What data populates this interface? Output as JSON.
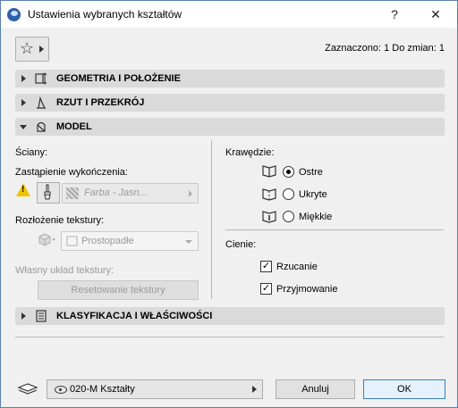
{
  "window": {
    "title": "Ustawienia wybranych kształtów",
    "help": "?",
    "close": "✕"
  },
  "toolbar": {
    "selection_info": "Zaznaczono: 1 Do zmian: 1"
  },
  "sections": {
    "geometry": "GEOMETRIA I POŁOŻENIE",
    "plan": "RZUT I PRZEKRÓJ",
    "model": "MODEL",
    "classification": "KLASYFIKACJA I WŁAŚCIWOŚCI"
  },
  "model": {
    "walls_label": "Ściany:",
    "override_label": "Zastąpienie wykończenia:",
    "surface_value": "Farba - Jasn...",
    "texture_mapping_label": "Rozłożenie tekstury:",
    "texture_mapping_value": "Prostopadłe",
    "custom_texture_label": "Własny układ tekstury:",
    "reset_texture_button": "Resetowanie tekstury",
    "edges_label": "Krawędzie:",
    "edges_options": [
      "Ostre",
      "Ukryte",
      "Miękkie"
    ],
    "edges_selected": "Ostre",
    "shadows_label": "Cienie:",
    "cast_shadows": "Rzucanie",
    "receive_shadows": "Przyjmowanie",
    "cast_checked": true,
    "receive_checked": true
  },
  "footer": {
    "layer_value": "020-M Kształty",
    "cancel_button": "Anuluj",
    "ok_button": "OK"
  },
  "colors": {
    "accent": "#2d5fa8",
    "section_bg": "#dadada",
    "warning": "#f2c300"
  }
}
